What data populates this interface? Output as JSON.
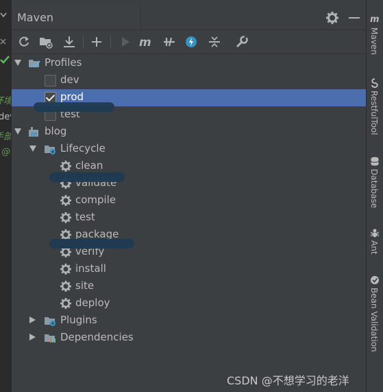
{
  "panel": {
    "title": "Maven"
  },
  "gutter": {
    "fragments": [
      "环境",
      "dev",
      "手部",
      "@"
    ]
  },
  "toolbar": {
    "icons": [
      "reload-icon",
      "add-folder-icon",
      "download-icon",
      "plus-icon",
      "run-icon",
      "maven-m-icon",
      "toggle-offline-icon",
      "skip-tests-icon",
      "collapse-all-icon",
      "wrench-icon"
    ]
  },
  "tree": {
    "profiles": {
      "label": "Profiles",
      "items": [
        {
          "label": "dev",
          "checked": false
        },
        {
          "label": "prod",
          "checked": true
        },
        {
          "label": "test",
          "checked": false
        }
      ]
    },
    "project": {
      "label": "blog",
      "lifecycle": {
        "label": "Lifecycle",
        "goals": [
          "clean",
          "validate",
          "compile",
          "test",
          "package",
          "verify",
          "install",
          "site",
          "deploy"
        ]
      },
      "plugins": {
        "label": "Plugins"
      },
      "dependencies": {
        "label": "Dependencies"
      }
    }
  },
  "rightbar": {
    "items": [
      {
        "label": "Maven",
        "icon": "maven-m-icon"
      },
      {
        "label": "RestfulTool",
        "icon": "restful-icon"
      },
      {
        "label": "Database",
        "icon": "database-icon"
      },
      {
        "label": "Ant",
        "icon": "ant-icon"
      },
      {
        "label": "Bean Validation",
        "icon": "bean-validation-icon"
      }
    ]
  },
  "watermark": "CSDN @不想学习的老洋",
  "colors": {
    "selection": "#4b6eaf",
    "background": "#3c3f41",
    "accent": "#3592c4"
  }
}
